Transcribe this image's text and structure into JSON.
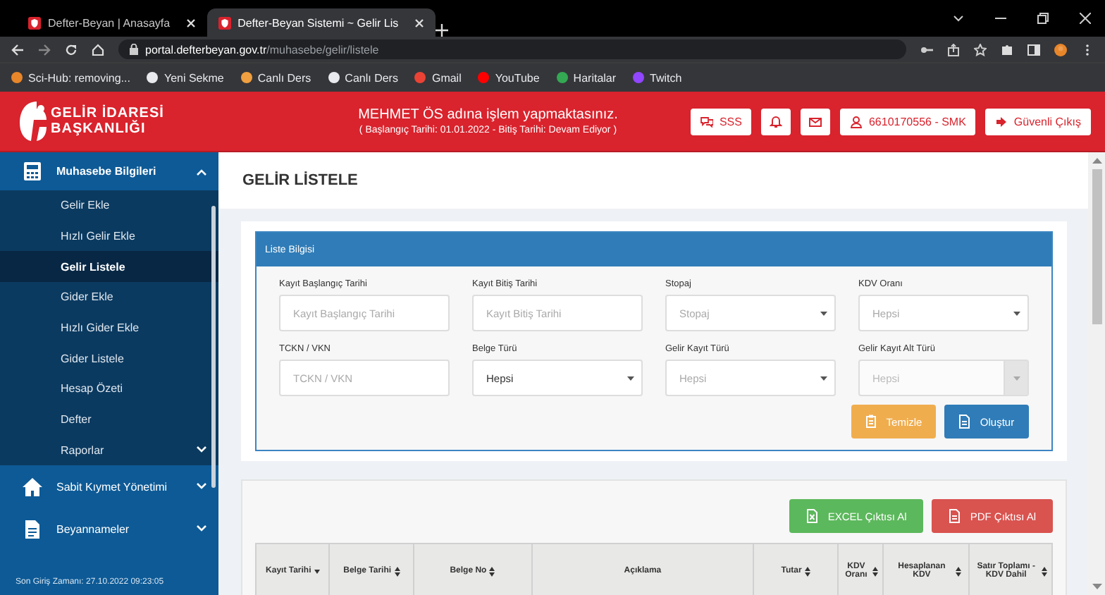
{
  "browser": {
    "tabs": [
      {
        "title": "Defter-Beyan | Anasayfa",
        "selected": false
      },
      {
        "title": "Defter-Beyan Sistemi ~ Gelir Lis",
        "selected": true
      }
    ],
    "url": {
      "host": "portal.defterbeyan.gov.tr",
      "path": "/muhasebe/gelir/listele"
    },
    "bookmarks": [
      {
        "label": "Sci-Hub: removing...",
        "color": "#e8862a"
      },
      {
        "label": "Yeni Sekme",
        "color": "#e8eaed"
      },
      {
        "label": "Canlı Ders",
        "color": "#f0a040"
      },
      {
        "label": "Canlı Ders",
        "color": "#e8eaed"
      },
      {
        "label": "Gmail",
        "color": "#ea4335"
      },
      {
        "label": "YouTube",
        "color": "#ff0000"
      },
      {
        "label": "Haritalar",
        "color": "#34a853"
      },
      {
        "label": "Twitch",
        "color": "#9146ff"
      }
    ]
  },
  "header": {
    "logo_lines": [
      "GELİR İDARESİ",
      "BAŞKANLIĞI"
    ],
    "user_message": "MEHMET ÖS adına işlem yapmaktasınız.",
    "period_note": "( Başlangıç Tarihi: 01.01.2022 - Bitiş Tarihi: Devam Ediyor )",
    "actions": [
      {
        "kind": "faq",
        "label": "SSS"
      },
      {
        "kind": "notifications"
      },
      {
        "kind": "messages"
      },
      {
        "kind": "user",
        "label": "6610170556 - SMK"
      },
      {
        "kind": "logout",
        "label": "Güvenli Çıkış"
      }
    ]
  },
  "sidebar": {
    "sections": [
      {
        "label": "Muhasebe Bilgileri",
        "expanded": true,
        "children": [
          {
            "label": "Gelir Ekle",
            "selected": false,
            "has_submenu": false
          },
          {
            "label": "Hızlı Gelir Ekle",
            "selected": false,
            "has_submenu": false
          },
          {
            "label": "Gelir Listele",
            "selected": true,
            "has_submenu": false
          },
          {
            "label": "Gider Ekle",
            "selected": false,
            "has_submenu": false
          },
          {
            "label": "Hızlı Gider Ekle",
            "selected": false,
            "has_submenu": false
          },
          {
            "label": "Gider Listele",
            "selected": false,
            "has_submenu": false
          },
          {
            "label": "Hesap Özeti",
            "selected": false,
            "has_submenu": false
          },
          {
            "label": "Defter",
            "selected": false,
            "has_submenu": false
          },
          {
            "label": "Raporlar",
            "selected": false,
            "has_submenu": true
          }
        ]
      },
      {
        "label": "Sabit Kıymet Yönetimi",
        "expanded": false
      },
      {
        "label": "Beyannameler",
        "expanded": false
      }
    ],
    "last_login": "Son Giriş Zamanı: 27.10.2022 09:23:05"
  },
  "page_title": "GELİR LİSTELE",
  "filter_panel": {
    "title": "Liste Bilgisi",
    "fields": [
      {
        "kind": "input",
        "label": "Kayıt Başlangıç Tarihi",
        "placeholder": "Kayıt Başlangıç Tarihi",
        "disabled": false
      },
      {
        "kind": "input",
        "label": "Kayıt Bitiş Tarihi",
        "placeholder": "Kayıt Bitiş Tarihi",
        "disabled": false
      },
      {
        "kind": "select",
        "label": "Stopaj",
        "placeholder": "Stopaj",
        "disabled": false
      },
      {
        "kind": "select",
        "label": "KDV Oranı",
        "placeholder": "Hepsi",
        "disabled": false
      },
      {
        "kind": "input",
        "label": "TCKN / VKN",
        "placeholder": "TCKN / VKN",
        "disabled": false
      },
      {
        "kind": "select",
        "label": "Belge Türü",
        "value": "Hepsi",
        "disabled": false
      },
      {
        "kind": "select",
        "label": "Gelir Kayıt Türü",
        "placeholder": "Hepsi",
        "disabled": false
      },
      {
        "kind": "select",
        "label": "Gelir Kayıt Alt Türü",
        "placeholder": "Hepsi",
        "disabled": true
      }
    ],
    "buttons": [
      {
        "kind": "clear",
        "label": "Temizle"
      },
      {
        "kind": "create",
        "label": "Oluştur"
      }
    ]
  },
  "results": {
    "export_buttons": [
      {
        "kind": "excel",
        "label": "EXCEL Çıktısı Al"
      },
      {
        "kind": "pdf",
        "label": "PDF Çıktısı Al"
      }
    ],
    "columns": [
      {
        "label": "Kayıt Tarihi",
        "sortable": true,
        "sorted": true
      },
      {
        "label": "Belge Tarihi",
        "sortable": true,
        "sorted": false
      },
      {
        "label": "Belge No",
        "sortable": true,
        "sorted": false
      },
      {
        "label": "Açıklama",
        "sortable": false,
        "sorted": false
      },
      {
        "label": "Tutar",
        "sortable": true,
        "sorted": false
      },
      {
        "label": "KDV Oranı",
        "sortable": true,
        "sorted": false
      },
      {
        "label": "Hesaplanan KDV",
        "sortable": true,
        "sorted": false
      },
      {
        "label": "Satır Toplamı - KDV Dahil",
        "sortable": true,
        "sorted": false
      }
    ]
  }
}
